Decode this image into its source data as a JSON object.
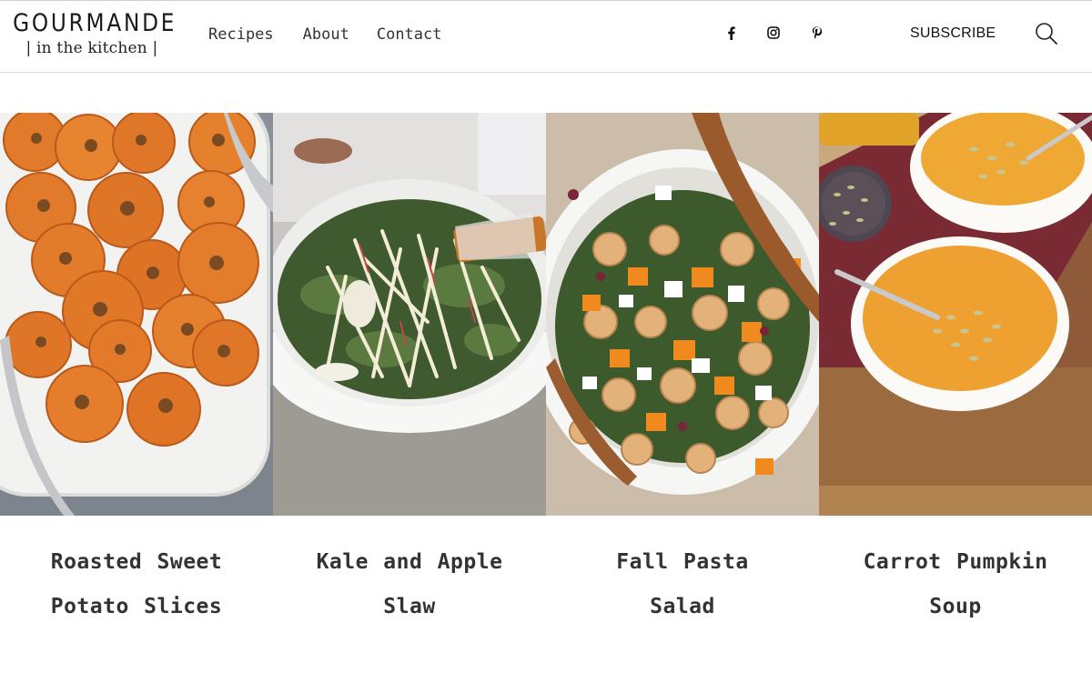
{
  "brand": {
    "name": "GOURMANDE",
    "tagline": "| in the kitchen |"
  },
  "nav": [
    {
      "label": "Recipes"
    },
    {
      "label": "About"
    },
    {
      "label": "Contact"
    }
  ],
  "social": [
    {
      "icon": "facebook-icon"
    },
    {
      "icon": "instagram-icon"
    },
    {
      "icon": "pinterest-icon"
    }
  ],
  "header": {
    "subscribe_label": "SUBSCRIBE",
    "search_icon": "search-icon"
  },
  "recipes": [
    {
      "title": "Roasted Sweet Potato Slices"
    },
    {
      "title": "Kale and Apple Slaw"
    },
    {
      "title": "Fall Pasta Salad"
    },
    {
      "title": "Carrot Pumpkin Soup"
    }
  ],
  "colors": {
    "header_border": "#d7d7d7",
    "text": "#333333"
  }
}
